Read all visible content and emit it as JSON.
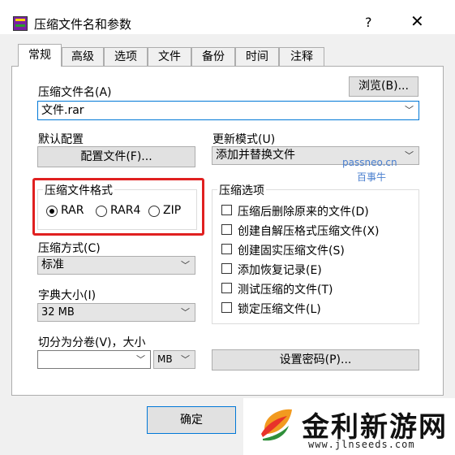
{
  "window": {
    "title": "压缩文件名和参数",
    "help": "?",
    "close": "✕"
  },
  "tabs": [
    "常规",
    "高级",
    "选项",
    "文件",
    "备份",
    "时间",
    "注释"
  ],
  "archive_name": {
    "label": "压缩文件名(A)",
    "value": "文件.rar",
    "browse": "浏览(B)..."
  },
  "profiles": {
    "label": "默认配置",
    "button": "配置文件(F)..."
  },
  "update_mode": {
    "label": "更新模式(U)",
    "value": "添加并替换文件"
  },
  "watermark": {
    "line1": "passneo.cn",
    "line2": "百事牛"
  },
  "format": {
    "title": "压缩文件格式",
    "options": [
      "RAR",
      "RAR4",
      "ZIP"
    ],
    "selected": "RAR"
  },
  "options": {
    "title": "压缩选项",
    "items": [
      "压缩后删除原来的文件(D)",
      "创建自解压格式压缩文件(X)",
      "创建固实压缩文件(S)",
      "添加恢复记录(E)",
      "测试压缩的文件(T)",
      "锁定压缩文件(L)"
    ]
  },
  "method": {
    "label": "压缩方式(C)",
    "value": "标准"
  },
  "dict": {
    "label": "字典大小(I)",
    "value": "32 MB"
  },
  "split": {
    "label": "切分为分卷(V)，大小",
    "value": "",
    "unit": "MB"
  },
  "password_button": "设置密码(P)...",
  "ok_button": "确定",
  "logo": {
    "text": "金利新游网",
    "url": "www.jlnseeds.com"
  }
}
